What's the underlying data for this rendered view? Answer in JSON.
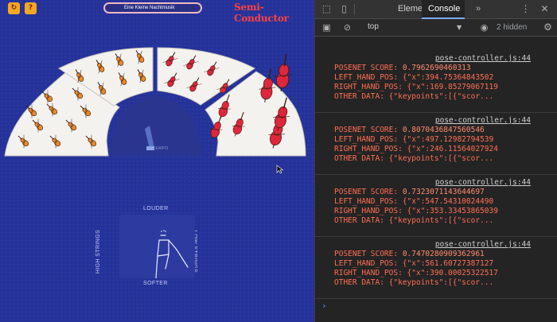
{
  "app": {
    "restart_icon": "restart-icon",
    "help_label": "?",
    "piece_title": "Eine Kleine Nachtmusik",
    "logo_text": "Semi-Conductor",
    "tempo_label": "TEMPO",
    "pad": {
      "louder": "LOUDER",
      "softer": "SOFTER",
      "high_strings": "HIGH STRINGS",
      "low_strings": "LOW STRINGS"
    },
    "colors": {
      "background": "#25329a",
      "logo": "#ff4141",
      "instrument_red": "#e0263a",
      "instrument_orange": "#e88a2a"
    }
  },
  "devtools": {
    "tabs": [
      "Elements",
      "Console"
    ],
    "active_tab": "Console",
    "more_label": "»",
    "context": "top",
    "hidden_count": "2 hidden",
    "logs": [
      {
        "source": "pose-controller.js:44",
        "score_label": "POSENET SCORE:",
        "score": "0.7962690460313",
        "left_label": "LEFT_HAND_POS:",
        "left_val": "{\"x\":394.75364843502",
        "right_label": "RIGHT_HAND_POS:",
        "right_val": "{\"x\":169.85279067119",
        "other_label": "OTHER DATA:",
        "other_val": "{\"keypoints\":[{\"scor..."
      },
      {
        "source": "pose-controller.js:44",
        "score_label": "POSENET SCORE:",
        "score": "0.8070436847560546",
        "left_label": "LEFT_HAND_POS:",
        "left_val": "{\"x\":497.12982794539",
        "right_label": "RIGHT_HAND_POS:",
        "right_val": "{\"x\":246.11564027924",
        "other_label": "OTHER DATA:",
        "other_val": "{\"keypoints\":[{\"scor..."
      },
      {
        "source": "pose-controller.js:44",
        "score_label": "POSENET SCORE:",
        "score": "0.7323071143644697",
        "left_label": "LEFT_HAND_POS:",
        "left_val": "{\"x\":547.54310024490",
        "right_label": "RIGHT_HAND_POS:",
        "right_val": "{\"x\":353.33453865039",
        "other_label": "OTHER DATA:",
        "other_val": "{\"keypoints\":[{\"scor..."
      },
      {
        "source": "pose-controller.js:44",
        "score_label": "POSENET SCORE:",
        "score": "0.7470280909362961",
        "left_label": "LEFT_HAND_POS:",
        "left_val": "{\"x\":561.60727387127",
        "right_label": "RIGHT_HAND_POS:",
        "right_val": "{\"x\":390.00025322517",
        "other_label": "OTHER DATA:",
        "other_val": "{\"keypoints\":[{\"scor..."
      }
    ],
    "prompt": "›"
  }
}
